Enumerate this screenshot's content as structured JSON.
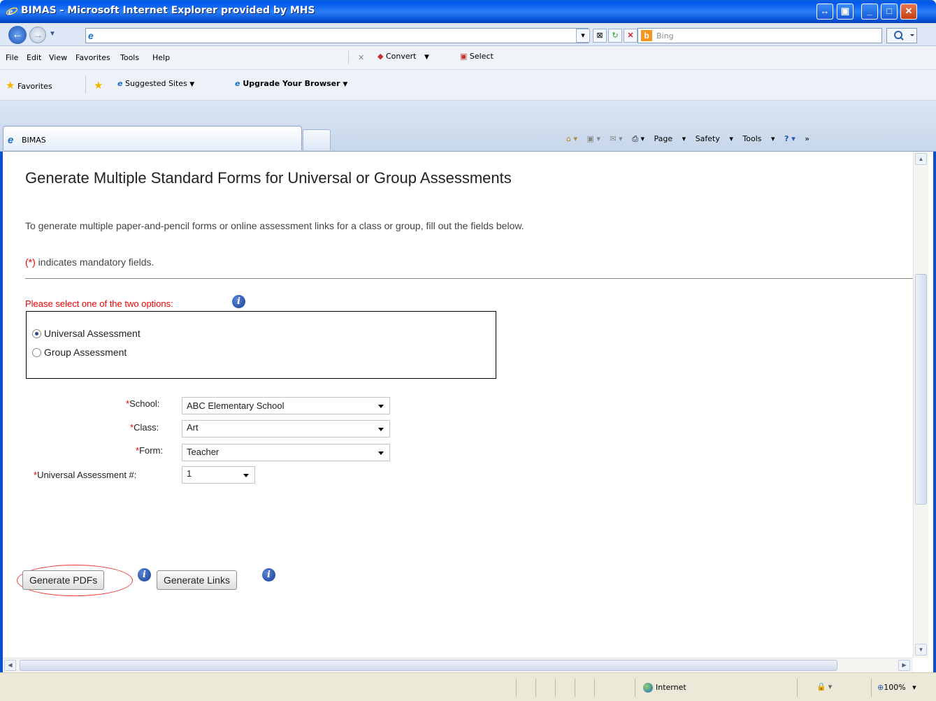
{
  "window": {
    "title": "BIMAS - Microsoft Internet Explorer provided by MHS"
  },
  "address_bar": {
    "url": ""
  },
  "search": {
    "placeholder": "Bing"
  },
  "menu": {
    "items": [
      "File",
      "Edit",
      "View",
      "Favorites",
      "Tools",
      "Help"
    ]
  },
  "pdf_toolbar": {
    "convert_label": "Convert",
    "select_label": "Select"
  },
  "favorites_bar": {
    "favorites_label": "Favorites",
    "suggested_sites": "Suggested Sites",
    "upgrade": "Upgrade Your Browser"
  },
  "tab": {
    "label": "BIMAS"
  },
  "command_bar": {
    "page": "Page",
    "safety": "Safety",
    "tools": "Tools"
  },
  "page": {
    "title": "Generate Multiple Standard Forms for Universal or Group Assessments",
    "intro": "To generate multiple paper-and-pencil forms or online assessment links for a class or group, fill out the fields below.",
    "mandatory_star": "(*)",
    "mandatory_text": " indicates mandatory fields.",
    "options_label": "Please select one of the two options:",
    "options": [
      {
        "label": "Universal Assessment",
        "selected": true
      },
      {
        "label": "Group Assessment",
        "selected": false
      }
    ],
    "required_mark": "*",
    "fields": {
      "school": {
        "label": "School:",
        "value": "ABC Elementary School"
      },
      "class": {
        "label": "Class:",
        "value": "Art"
      },
      "form": {
        "label": "Form:",
        "value": "Teacher"
      },
      "assessment_num": {
        "label": "Universal Assessment #:",
        "value": "1"
      }
    },
    "buttons": {
      "generate_pdfs": "Generate PDFs",
      "generate_links": "Generate Links"
    }
  },
  "status": {
    "zone": "Internet",
    "zoom": "100%"
  },
  "colors": {
    "required": "#e00000",
    "titlebar": "#0058ee",
    "highlight_circle": "#e33333"
  }
}
